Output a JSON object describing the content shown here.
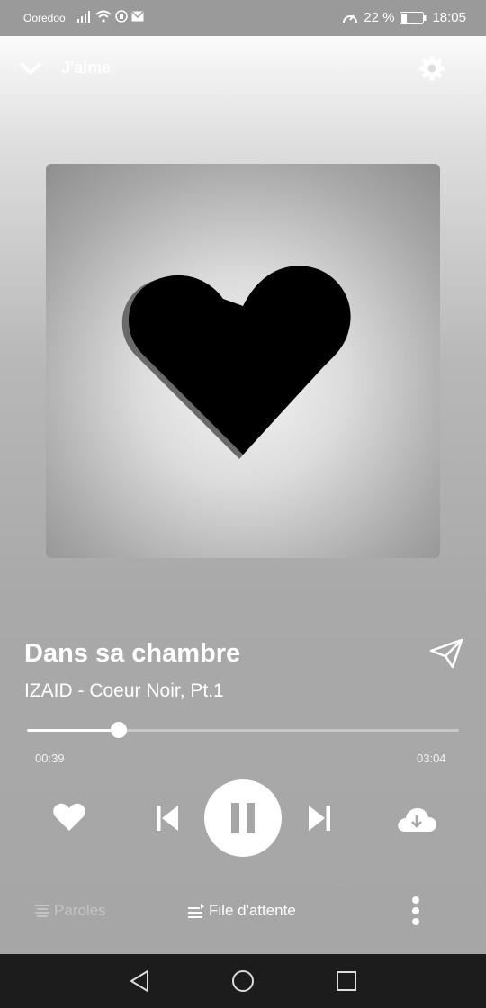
{
  "status_bar": {
    "carrier": "Ooredoo",
    "battery_percent": "22 %",
    "time": "18:05"
  },
  "header": {
    "playlist_title": "J'aime"
  },
  "track": {
    "title": "Dans sa chambre",
    "artist_album": "IZAID - Coeur Noir, Pt.1",
    "elapsed": "00:39",
    "duration": "03:04",
    "progress_fraction": 0.212
  },
  "bottom_bar": {
    "lyrics_label": "Paroles",
    "queue_label": "File d'attente"
  },
  "colors": {
    "accent": "#ffffff",
    "nav_bar": "#1c1c1c"
  }
}
